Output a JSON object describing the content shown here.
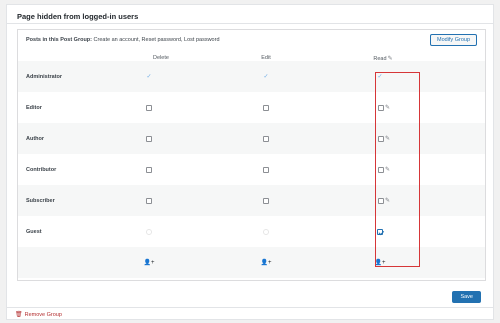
{
  "panel": {
    "title": "Page hidden from logged-in users"
  },
  "group": {
    "posts_label": "Posts in this Post Group:",
    "posts_list": "Create an account, Reset password, Lost password",
    "modify_label": "Modify Group"
  },
  "columns": [
    {
      "label": "Delete"
    },
    {
      "label": "Edit"
    },
    {
      "label": "Read"
    }
  ],
  "rows": [
    {
      "label": "Administrator",
      "delete": "tick",
      "edit": "tick",
      "read": "tick"
    },
    {
      "label": "Editor",
      "delete": "unchecked",
      "edit": "unchecked",
      "read": "unchecked"
    },
    {
      "label": "Author",
      "delete": "unchecked",
      "edit": "unchecked",
      "read": "unchecked"
    },
    {
      "label": "Contributor",
      "delete": "unchecked",
      "edit": "unchecked",
      "read": "unchecked"
    },
    {
      "label": "Subscriber",
      "delete": "unchecked",
      "edit": "unchecked",
      "read": "unchecked"
    },
    {
      "label": "Guest",
      "delete": "disabled",
      "edit": "disabled",
      "read": "checked"
    }
  ],
  "actions": {
    "save_label": "Save",
    "remove_label": "Remove Group"
  },
  "colors": {
    "accent": "#2271b1",
    "danger": "#d63638",
    "remove": "#b32d2e"
  },
  "icons": {
    "edit": "pencil-icon",
    "add_user": "add-user-icon",
    "trash": "trash-icon"
  }
}
